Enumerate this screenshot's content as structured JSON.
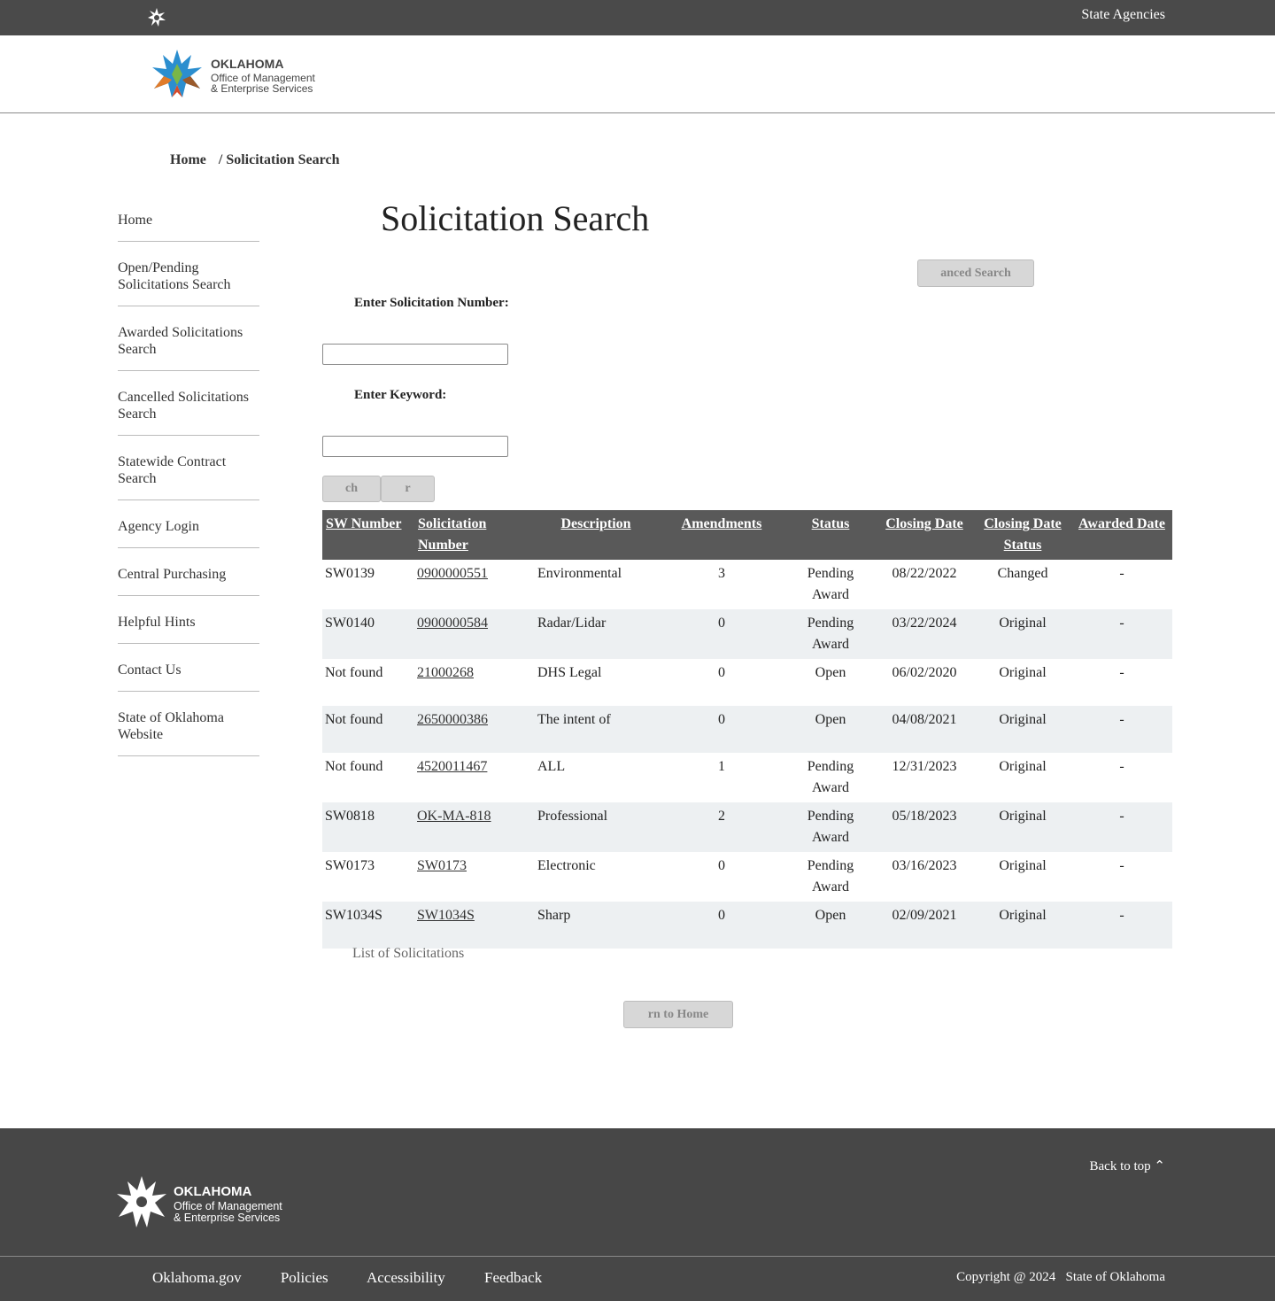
{
  "topbar": {
    "logo_icon": "oklahoma-star-icon",
    "agencies_link": "State Agencies"
  },
  "header": {
    "logo_line1": "OKLAHOMA",
    "logo_line2": "Office of Management",
    "logo_line3": "& Enterprise Services"
  },
  "breadcrumb": {
    "home": "Home",
    "current": "/ Solicitation Search"
  },
  "sidebar": {
    "items": [
      {
        "label": "Home"
      },
      {
        "label": "Open/Pending Solicitations Search"
      },
      {
        "label": "Awarded Solicitations Search"
      },
      {
        "label": "Cancelled Solicitations Search"
      },
      {
        "label": "Statewide Contract Search"
      },
      {
        "label": "Agency Login"
      },
      {
        "label": "Central Purchasing"
      },
      {
        "label": "Helpful Hints"
      },
      {
        "label": "Contact Us"
      },
      {
        "label": "State of Oklahoma Website"
      }
    ]
  },
  "main": {
    "title": "Solicitation Search",
    "advanced_search_label": "anced Search",
    "solicitation_number_label": "Enter Solicitation Number:",
    "solicitation_number_value": "",
    "keyword_label": "Enter Keyword:",
    "keyword_value": "",
    "search_label": "ch",
    "clear_label": "r",
    "caption": "List of Solicitations",
    "return_home_label": "rn to Home"
  },
  "table": {
    "headers": {
      "sw_number": "SW Number",
      "solicitation_number": "Solicitation Number",
      "description": "Description",
      "amendments": "Amendments",
      "status": "Status",
      "closing_date": "Closing Date",
      "closing_date_status": "Closing Date Status",
      "awarded_date": "Awarded Date"
    },
    "rows": [
      {
        "sw": "SW0139",
        "sol": "0900000551",
        "desc": "Environmental",
        "amend": "3",
        "status": "Pending Award",
        "close": "08/22/2022",
        "close_status": "Changed",
        "awarded": "-"
      },
      {
        "sw": "SW0140",
        "sol": "0900000584",
        "desc": "Radar/Lidar",
        "amend": "0",
        "status": "Pending Award",
        "close": "03/22/2024",
        "close_status": "Original",
        "awarded": "-"
      },
      {
        "sw": "Not found",
        "sol": "21000268",
        "desc": "DHS Legal",
        "amend": "0",
        "status": "Open",
        "close": "06/02/2020",
        "close_status": "Original",
        "awarded": "-"
      },
      {
        "sw": "Not found",
        "sol": "2650000386",
        "desc": "The intent of",
        "amend": "0",
        "status": "Open",
        "close": "04/08/2021",
        "close_status": "Original",
        "awarded": "-"
      },
      {
        "sw": "Not found",
        "sol": "4520011467",
        "desc": "ALL",
        "amend": "1",
        "status": "Pending Award",
        "close": "12/31/2023",
        "close_status": "Original",
        "awarded": "-"
      },
      {
        "sw": "SW0818",
        "sol": "OK-MA-818",
        "desc": "Professional",
        "amend": "2",
        "status": "Pending Award",
        "close": "05/18/2023",
        "close_status": "Original",
        "awarded": "-"
      },
      {
        "sw": "SW0173",
        "sol": "SW0173",
        "desc": "Electronic",
        "amend": "0",
        "status": "Pending Award",
        "close": "03/16/2023",
        "close_status": "Original",
        "awarded": "-"
      },
      {
        "sw": "SW1034S",
        "sol": "SW1034S",
        "desc": "Sharp",
        "amend": "0",
        "status": "Open",
        "close": "02/09/2021",
        "close_status": "Original",
        "awarded": "-"
      }
    ]
  },
  "footer": {
    "logo_line1": "OKLAHOMA",
    "logo_line2": "Office of Management",
    "logo_line3": "& Enterprise Services",
    "back_to_top": "Back to top",
    "links": [
      {
        "label": "Oklahoma.gov"
      },
      {
        "label": "Policies"
      },
      {
        "label": "Accessibility"
      },
      {
        "label": "Feedback"
      }
    ],
    "copyright": "Copyright @",
    "year": "2024",
    "state": "State of Oklahoma"
  },
  "colors": {
    "topbar": "#4a4a4a",
    "table_header": "#595959",
    "row_alt": "#edf0f2",
    "footer": "#474747"
  }
}
